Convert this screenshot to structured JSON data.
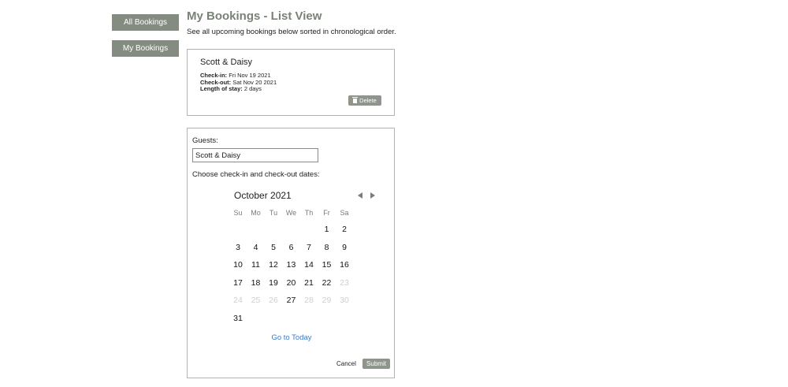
{
  "sidebar": {
    "all_bookings": "All Bookings",
    "my_bookings": "My Bookings"
  },
  "header": {
    "title": "My Bookings - List View",
    "subtitle": "See all upcoming bookings below sorted in chronological order."
  },
  "booking": {
    "name": "Scott & Daisy",
    "checkin_label": "Check-in:",
    "checkin_value": " Fri Nov 19 2021",
    "checkout_label": "Check-out:",
    "checkout_value": " Sat Nov 20 2021",
    "length_label": "Length of stay:",
    "length_value": " 2 days",
    "delete_label": "Delete"
  },
  "form": {
    "guests_label": "Guests:",
    "guests_value": "Scott & Daisy",
    "dates_label": "Choose check-in and check-out dates:",
    "calendar": {
      "month": "October 2021",
      "weekdays": [
        "Su",
        "Mo",
        "Tu",
        "We",
        "Th",
        "Fr",
        "Sa"
      ],
      "weeks": [
        [
          null,
          null,
          null,
          null,
          null,
          {
            "d": "1"
          },
          {
            "d": "2"
          }
        ],
        [
          {
            "d": "3"
          },
          {
            "d": "4"
          },
          {
            "d": "5"
          },
          {
            "d": "6"
          },
          {
            "d": "7"
          },
          {
            "d": "8"
          },
          {
            "d": "9"
          }
        ],
        [
          {
            "d": "10"
          },
          {
            "d": "11"
          },
          {
            "d": "12"
          },
          {
            "d": "13"
          },
          {
            "d": "14"
          },
          {
            "d": "15"
          },
          {
            "d": "16"
          }
        ],
        [
          {
            "d": "17"
          },
          {
            "d": "18"
          },
          {
            "d": "19"
          },
          {
            "d": "20"
          },
          {
            "d": "21"
          },
          {
            "d": "22"
          },
          {
            "d": "23",
            "muted": true
          }
        ],
        [
          {
            "d": "24",
            "muted": true
          },
          {
            "d": "25",
            "muted": true
          },
          {
            "d": "26",
            "muted": true
          },
          {
            "d": "27"
          },
          {
            "d": "28",
            "muted": true
          },
          {
            "d": "29",
            "muted": true
          },
          {
            "d": "30",
            "muted": true
          }
        ],
        [
          {
            "d": "31"
          },
          null,
          null,
          null,
          null,
          null,
          null
        ]
      ],
      "go_today": "Go to Today"
    },
    "cancel_label": "Cancel",
    "submit_label": "Submit"
  }
}
